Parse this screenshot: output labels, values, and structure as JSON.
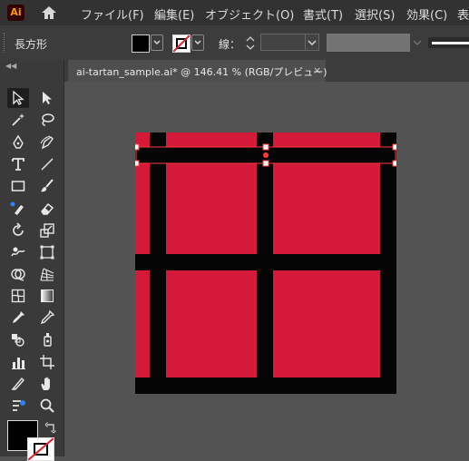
{
  "app": {
    "logo_text": "Ai"
  },
  "menu": [
    "ファイル(F)",
    "編集(E)",
    "オブジェクト(O)",
    "書式(T)",
    "選択(S)",
    "効果(C)",
    "表"
  ],
  "control_bar": {
    "object_type": "長方形",
    "fill_color": "#000000",
    "stroke_label": "線：",
    "stroke_value": ""
  },
  "document": {
    "tab_label": "ai-tartan_sample.ai* @ 146.41 % (RGB/プレビュー)",
    "close_glyph": "×"
  },
  "colors": {
    "menubar_bg": "#323232",
    "panel_bg": "#3c3c3c",
    "canvas_bg": "#535353",
    "tartan_red": "#d4193a",
    "tartan_black": "#050505",
    "selection": "#ff3b3b"
  },
  "tools": [
    "selection-tool",
    "direct-selection-tool",
    "magic-wand-tool",
    "lasso-tool",
    "pen-tool",
    "curvature-tool",
    "type-tool",
    "line-segment-tool",
    "rectangle-tool",
    "paintbrush-tool",
    "shaper-tool",
    "eraser-tool",
    "rotate-tool",
    "scale-tool",
    "warp-tool",
    "free-transform-tool",
    "shape-builder-tool",
    "perspective-grid-tool",
    "mesh-tool",
    "gradient-tool",
    "eyedropper-tool",
    "eyedropper-alt-tool",
    "blend-tool",
    "symbol-sprayer-tool",
    "graph-tool",
    "artboard-tool",
    "slice-tool",
    "hand-tool",
    "edit-toolbar-tool",
    "zoom-tool"
  ]
}
